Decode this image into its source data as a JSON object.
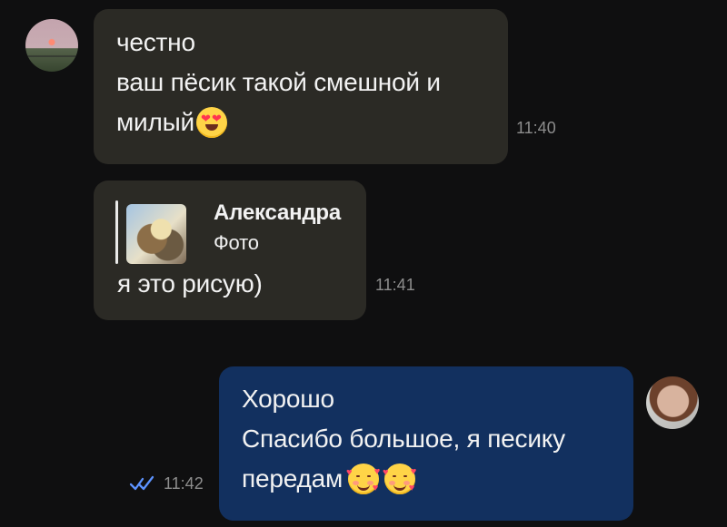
{
  "messages": {
    "incoming_1": {
      "lines": [
        "честно",
        "ваш пёсик такой смешной и",
        "милый"
      ],
      "emoji": "heart-eyes-emoji",
      "time": "11:40"
    },
    "incoming_2": {
      "reply": {
        "name": "Александра",
        "type": "Фото"
      },
      "text": "я это рисую)",
      "time": "11:41"
    },
    "outgoing_1": {
      "lines": [
        "Хорошо",
        "Спасибо большое, я песику",
        "передам"
      ],
      "emoji": [
        "smiling-face-with-hearts-emoji",
        "smiling-face-with-hearts-emoji"
      ],
      "time": "11:42",
      "status": "read"
    }
  },
  "colors": {
    "background": "#0f0f10",
    "incoming_bubble": "#2b2a25",
    "outgoing_bubble": "#12305f",
    "timestamp": "#8d8d8d",
    "read_icon": "#5d93ff"
  }
}
